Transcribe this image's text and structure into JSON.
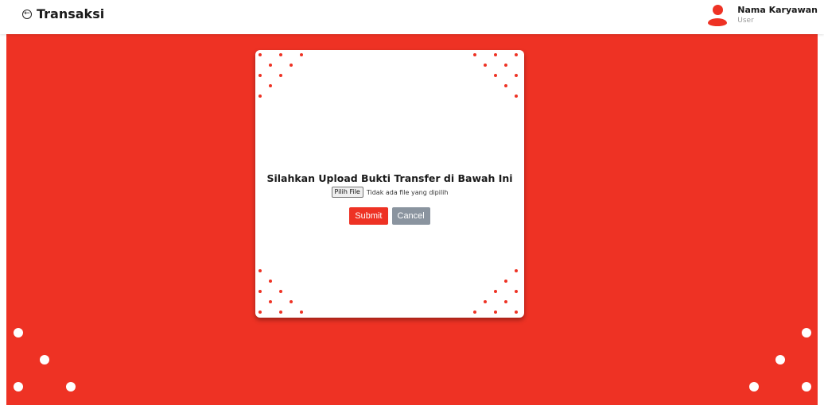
{
  "header": {
    "title": "Transaksi",
    "back_icon": "circle-arrow-left-icon",
    "user": {
      "name": "Nama Karyawan",
      "role": "User"
    }
  },
  "upload_card": {
    "heading": "Silahkan Upload Bukti Transfer di Bawah Ini",
    "file_button_label": "Pilih File",
    "file_status": "Tidak ada file yang dipilih",
    "submit_label": "Submit",
    "cancel_label": "Cancel"
  },
  "colors": {
    "accent": "#ee3224",
    "cancel": "#8a949f",
    "background": "#ffffff"
  }
}
